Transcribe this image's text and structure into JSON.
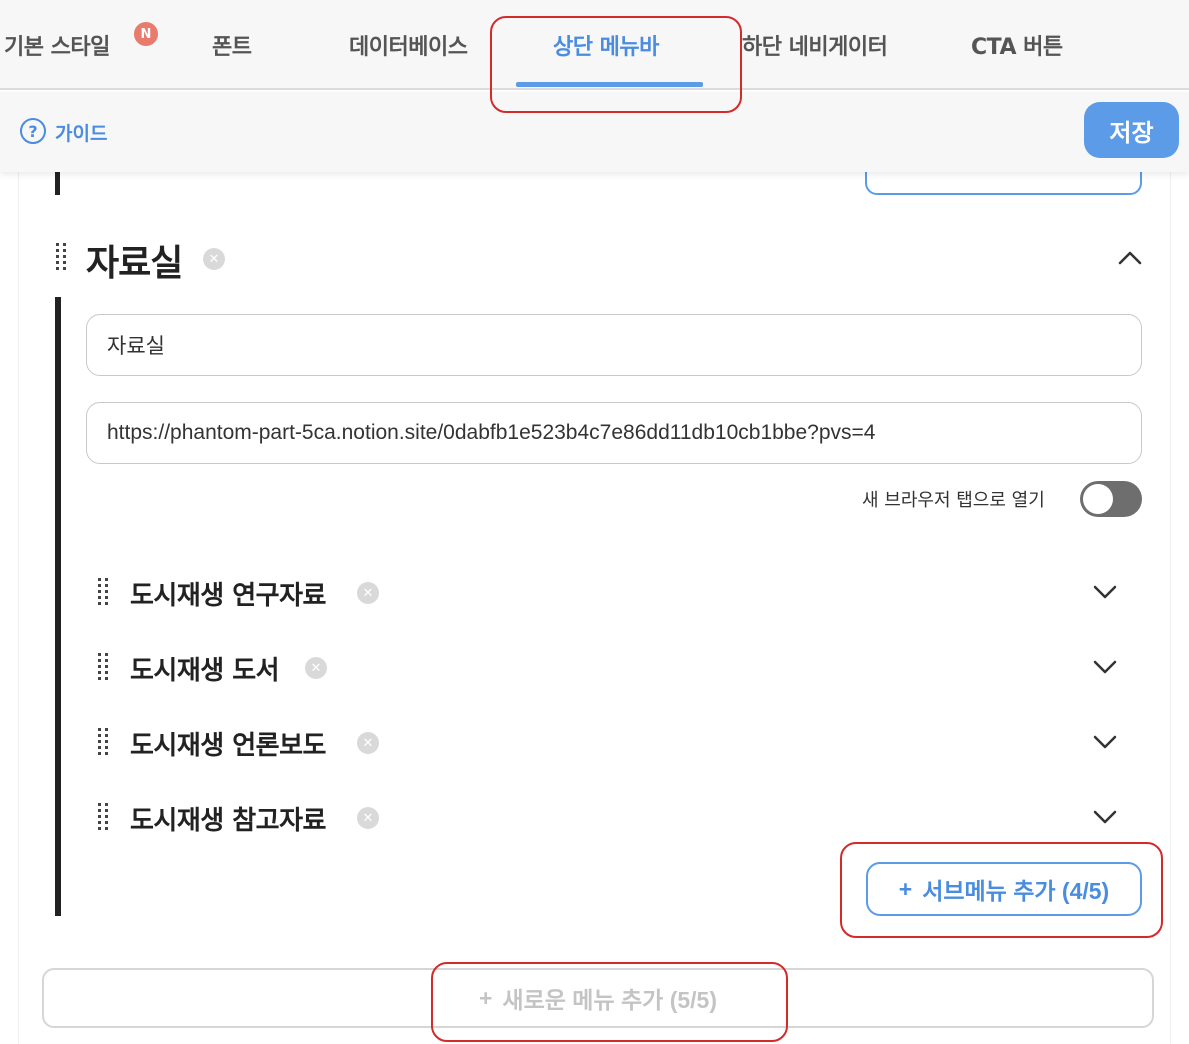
{
  "tabs": [
    {
      "label": "기본 스타일",
      "badge": "N"
    },
    {
      "label": "폰트"
    },
    {
      "label": "데이터베이스"
    },
    {
      "label": "상단 메뉴바",
      "active": true
    },
    {
      "label": "하단 네비게이터"
    },
    {
      "label": "CTA 버튼"
    }
  ],
  "guide": {
    "icon_glyph": "?",
    "label": "가이드"
  },
  "save_label": "저장",
  "section": {
    "title": "자료실",
    "name_value": "자료실",
    "url_value": "https://phantom-part-5ca.notion.site/0dabfb1e523b4c7e86dd11db10cb1bbe?pvs=4",
    "new_tab_label": "새 브라우저 탭으로 열기",
    "new_tab_enabled": false,
    "submenus": [
      {
        "label": "도시재생 연구자료"
      },
      {
        "label": "도시재생 도서"
      },
      {
        "label": "도시재생 언론보도"
      },
      {
        "label": "도시재생 참고자료"
      }
    ],
    "add_submenu": {
      "plus": "+",
      "label": "서브메뉴 추가 (4/5)"
    }
  },
  "add_menu": {
    "plus": "+",
    "label": "새로운 메뉴 추가 (5/5)"
  },
  "icons": {
    "delete": "x-circle-icon",
    "drag": "drag-handle-icon",
    "collapse": "chevron-up-icon",
    "expand": "chevron-down-icon",
    "guide": "question-circle-icon"
  },
  "colors": {
    "accent": "#5b9be8",
    "highlight": "#d42a2a",
    "badge": "#e87b6e"
  }
}
